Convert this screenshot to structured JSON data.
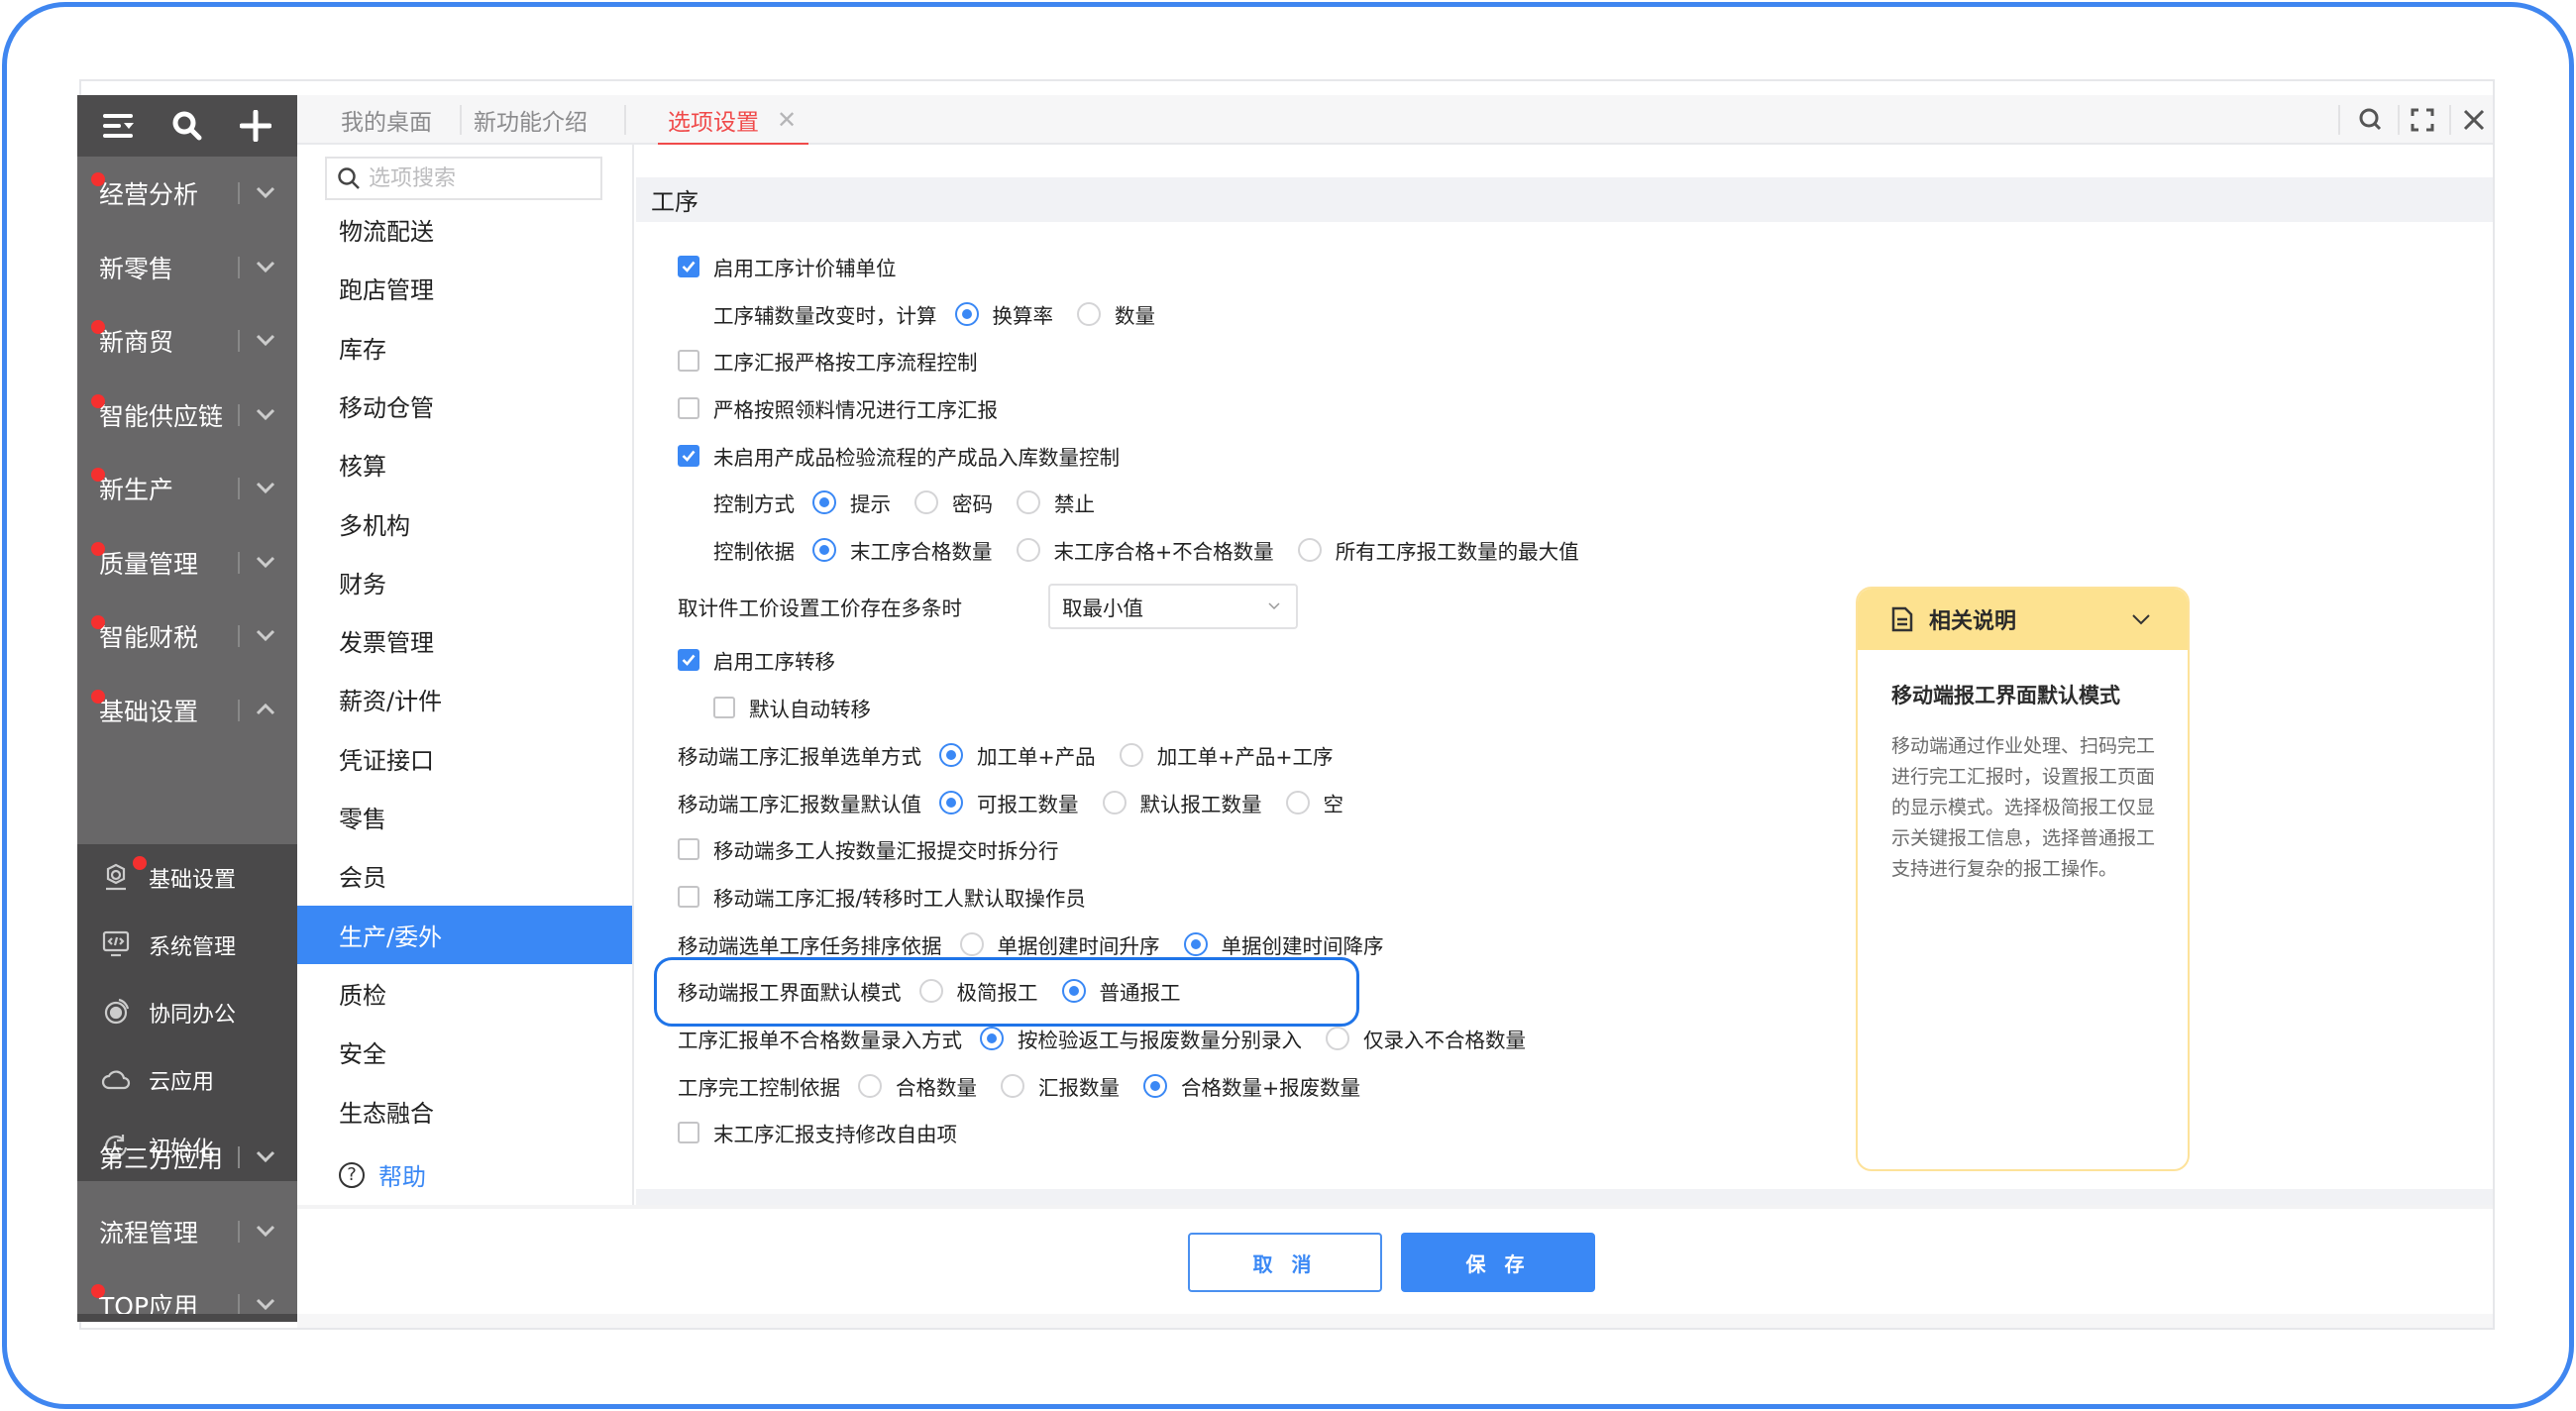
{
  "sidebar": {
    "top_icons": [
      "menu-collapse-icon",
      "search-icon",
      "plus-icon"
    ],
    "items": [
      {
        "label": "经营分析",
        "dot": true,
        "expanded": false
      },
      {
        "label": "新零售",
        "dot": false,
        "expanded": false
      },
      {
        "label": "新商贸",
        "dot": true,
        "expanded": false
      },
      {
        "label": "智能供应链",
        "dot": true,
        "expanded": false
      },
      {
        "label": "新生产",
        "dot": true,
        "expanded": false
      },
      {
        "label": "质量管理",
        "dot": true,
        "expanded": false
      },
      {
        "label": "智能财税",
        "dot": true,
        "expanded": false
      },
      {
        "label": "基础设置",
        "dot": true,
        "expanded": true
      }
    ],
    "sub_items": [
      {
        "label": "基础设置",
        "icon": "settings-gear-icon",
        "dot": true
      },
      {
        "label": "系统管理",
        "icon": "monitor-code-icon",
        "dot": false
      },
      {
        "label": "协同办公",
        "icon": "collaboration-icon",
        "dot": false
      },
      {
        "label": "云应用",
        "icon": "cloud-icon",
        "dot": false
      },
      {
        "label": "初始化",
        "icon": "reset-icon",
        "dot": false
      }
    ],
    "bottom_items": [
      {
        "label": "第三方应用",
        "dot": false
      },
      {
        "label": "流程管理",
        "dot": false
      },
      {
        "label": "TOP应用",
        "dot": true
      }
    ]
  },
  "tabs": [
    {
      "label": "我的桌面",
      "active": false
    },
    {
      "label": "新功能介绍",
      "active": false
    },
    {
      "label": "选项设置",
      "active": true,
      "closable": true
    }
  ],
  "window_controls": [
    "search-icon",
    "fullscreen-icon",
    "close-icon"
  ],
  "nav": {
    "search_placeholder": "选项搜索",
    "items": [
      "物流配送",
      "跑店管理",
      "库存",
      "移动仓管",
      "核算",
      "多机构",
      "财务",
      "发票管理",
      "薪资/计件",
      "凭证接口",
      "零售",
      "会员",
      "生产/委外",
      "质检",
      "安全",
      "生态融合"
    ],
    "active": "生产/委外",
    "help_label": "帮助"
  },
  "section": {
    "title": "工序",
    "rows": [
      {
        "type": "checkbox",
        "label": "启用工序计价辅单位",
        "checked": true,
        "indent": 0
      },
      {
        "type": "radio",
        "label": "工序辅数量改变时，计算",
        "indent": 1,
        "options": [
          "换算率",
          "数量"
        ],
        "selected": 0
      },
      {
        "type": "checkbox",
        "label": "工序汇报严格按工序流程控制",
        "checked": false,
        "indent": 0
      },
      {
        "type": "checkbox",
        "label": "严格按照领料情况进行工序汇报",
        "checked": false,
        "indent": 0
      },
      {
        "type": "checkbox",
        "label": "未启用产成品检验流程的产成品入库数量控制",
        "checked": true,
        "indent": 0
      },
      {
        "type": "radio",
        "label": "控制方式",
        "indent": 1,
        "options": [
          "提示",
          "密码",
          "禁止"
        ],
        "selected": 0
      },
      {
        "type": "radio",
        "label": "控制依据",
        "indent": 1,
        "options": [
          "末工序合格数量",
          "末工序合格+不合格数量",
          "所有工序报工数量的最大值"
        ],
        "selected": 0
      },
      {
        "type": "select",
        "label": "取计件工价设置工价存在多条时",
        "value": "取最小值"
      },
      {
        "type": "checkbox",
        "label": "启用工序转移",
        "checked": true,
        "indent": 0
      },
      {
        "type": "checkbox",
        "label": "默认自动转移",
        "checked": false,
        "indent": 1
      },
      {
        "type": "radio",
        "label": "移动端工序汇报单选单方式",
        "indent": 0,
        "options": [
          "加工单+产品",
          "加工单+产品+工序"
        ],
        "selected": 0
      },
      {
        "type": "radio",
        "label": "移动端工序汇报数量默认值",
        "indent": 0,
        "options": [
          "可报工数量",
          "默认报工数量",
          "空"
        ],
        "selected": 0
      },
      {
        "type": "checkbox",
        "label": "移动端多工人按数量汇报提交时拆分行",
        "checked": false,
        "indent": 0
      },
      {
        "type": "checkbox",
        "label": "移动端工序汇报/转移时工人默认取操作员",
        "checked": false,
        "indent": 0
      },
      {
        "type": "radio",
        "label": "移动端选单工序任务排序依据",
        "indent": 0,
        "options": [
          "单据创建时间升序",
          "单据创建时间降序"
        ],
        "selected": 1
      },
      {
        "type": "radio",
        "label": "移动端报工界面默认模式",
        "indent": 0,
        "options": [
          "极简报工",
          "普通报工"
        ],
        "selected": 1,
        "highlighted": true
      },
      {
        "type": "radio",
        "label": "工序汇报单不合格数量录入方式",
        "indent": 0,
        "options": [
          "按检验返工与报废数量分别录入",
          "仅录入不合格数量"
        ],
        "selected": 0
      },
      {
        "type": "radio",
        "label": "工序完工控制依据",
        "indent": 0,
        "options": [
          "合格数量",
          "汇报数量",
          "合格数量+报废数量"
        ],
        "selected": 2
      },
      {
        "type": "checkbox",
        "label": "末工序汇报支持修改自由项",
        "checked": false,
        "indent": 0
      }
    ]
  },
  "help_card": {
    "header": "相关说明",
    "title": "移动端报工界面默认模式",
    "body": "移动端通过作业处理、扫码完工进行完工汇报时，设置报工页面的显示模式。选择极简报工仅显示关键报工信息，选择普通报工支持进行复杂的报工操作。"
  },
  "footer": {
    "cancel_label": "取 消",
    "save_label": "保 存"
  },
  "colors": {
    "accent": "#3a88f5",
    "active_tab": "#f04a4a",
    "sidebar_bg": "#686768",
    "card_header": "#fde290",
    "highlight_border": "#1f74e8"
  }
}
